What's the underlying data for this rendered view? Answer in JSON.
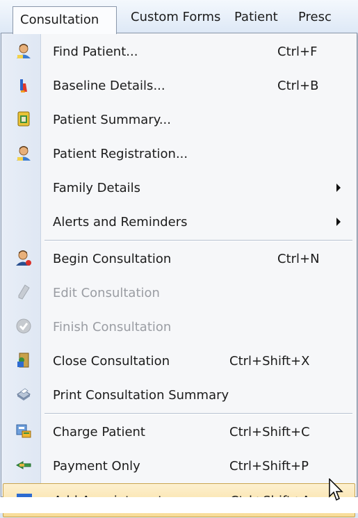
{
  "menubar": {
    "items": [
      "Consultation",
      "Custom Forms",
      "Patient",
      "Presc"
    ]
  },
  "menu": {
    "items": [
      {
        "label": "Find Patient...",
        "shortcut": "Ctrl+F",
        "icon": "find-patient-icon"
      },
      {
        "label": "Baseline Details...",
        "shortcut": "Ctrl+B",
        "icon": "baseline-details-icon"
      },
      {
        "label": "Patient Summary...",
        "shortcut": "",
        "icon": "patient-summary-icon"
      },
      {
        "label": "Patient Registration...",
        "shortcut": "",
        "icon": "patient-registration-icon"
      },
      {
        "label": "Family Details",
        "shortcut": "",
        "icon": "",
        "submenu": true
      },
      {
        "label": "Alerts and Reminders",
        "shortcut": "",
        "icon": "",
        "submenu": true
      },
      {
        "label": "Begin Consultation",
        "shortcut": "Ctrl+N",
        "icon": "begin-consultation-icon"
      },
      {
        "label": "Edit Consultation",
        "shortcut": "",
        "icon": "edit-consultation-icon",
        "disabled": true
      },
      {
        "label": "Finish Consultation",
        "shortcut": "",
        "icon": "finish-consultation-icon",
        "disabled": true
      },
      {
        "label": "Close Consultation",
        "shortcut": "Ctrl+Shift+X",
        "icon": "close-consultation-icon"
      },
      {
        "label": "Print Consultation Summary",
        "shortcut": "",
        "icon": "print-icon"
      },
      {
        "label": "Charge Patient",
        "shortcut": "Ctrl+Shift+C",
        "icon": "charge-patient-icon"
      },
      {
        "label": "Payment Only",
        "shortcut": "Ctrl+Shift+P",
        "icon": "payment-icon"
      },
      {
        "label": "Add Appointment",
        "shortcut": "Ctrl+Shift+A",
        "icon": "add-appointment-icon",
        "highlighted": true
      }
    ]
  },
  "colors": {
    "highlight": "#f8dc97",
    "disabled_text": "#9a9da3",
    "gutter": "#e3eaf5"
  }
}
